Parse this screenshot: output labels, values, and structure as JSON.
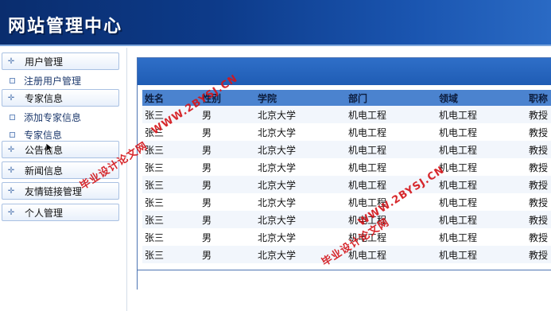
{
  "header": {
    "title": "网站管理中心"
  },
  "sidebar": {
    "groups": [
      {
        "label": "用户管理",
        "icon": "plus-icon"
      },
      {
        "label": "专家信息",
        "icon": "plus-icon"
      },
      {
        "label": "公告信息",
        "icon": "plus-icon"
      },
      {
        "label": "新闻信息",
        "icon": "plus-icon"
      },
      {
        "label": "友情链接管理",
        "icon": "plus-icon"
      },
      {
        "label": "个人管理",
        "icon": "plus-icon"
      }
    ],
    "items": [
      {
        "label": "注册用户管理"
      },
      {
        "label": "添加专家信息"
      },
      {
        "label": "专家信息"
      }
    ]
  },
  "table": {
    "columns": [
      "姓名",
      "性别",
      "学院",
      "部门",
      "领域",
      "职称"
    ],
    "rows": [
      [
        "张三",
        "男",
        "北京大学",
        "机电工程",
        "机电工程",
        "教授"
      ],
      [
        "张三",
        "男",
        "北京大学",
        "机电工程",
        "机电工程",
        "教授"
      ],
      [
        "张三",
        "男",
        "北京大学",
        "机电工程",
        "机电工程",
        "教授"
      ],
      [
        "张三",
        "男",
        "北京大学",
        "机电工程",
        "机电工程",
        "教授"
      ],
      [
        "张三",
        "男",
        "北京大学",
        "机电工程",
        "机电工程",
        "教授"
      ],
      [
        "张三",
        "男",
        "北京大学",
        "机电工程",
        "机电工程",
        "教授"
      ],
      [
        "张三",
        "男",
        "北京大学",
        "机电工程",
        "机电工程",
        "教授"
      ],
      [
        "张三",
        "男",
        "北京大学",
        "机电工程",
        "机电工程",
        "教授"
      ],
      [
        "张三",
        "男",
        "北京大学",
        "机电工程",
        "机电工程",
        "教授"
      ]
    ]
  },
  "watermarks": {
    "site": "WWW.2BYSJ.CN",
    "name": "毕业设计论文网"
  },
  "colors": {
    "header_bg": "#0d3b8a",
    "table_header_bg": "#4b83cf",
    "watermark": "#d4161b"
  }
}
